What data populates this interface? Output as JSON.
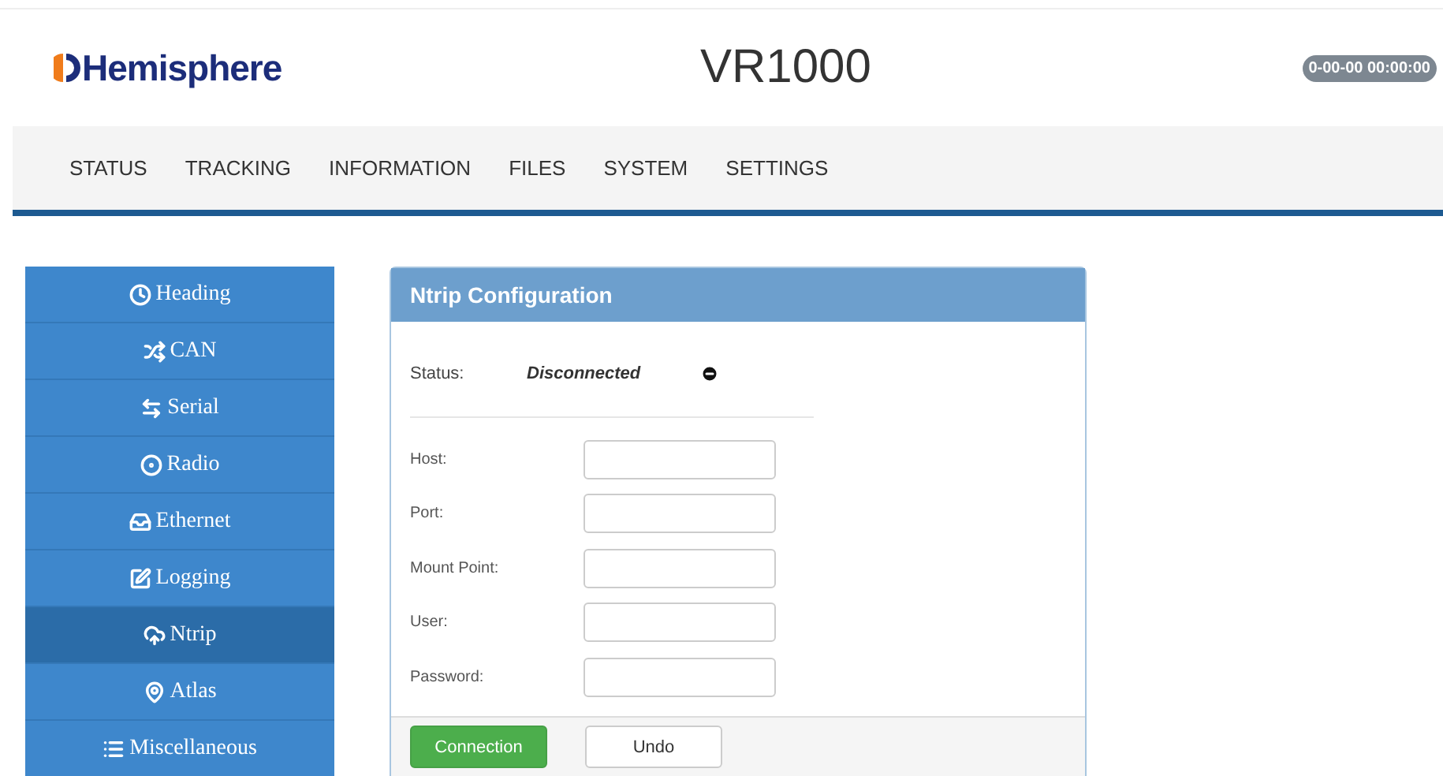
{
  "header": {
    "logo_text": "Hemisphere",
    "title": "VR1000",
    "clock": "0-00-00 00:00:00"
  },
  "nav": [
    "STATUS",
    "TRACKING",
    "INFORMATION",
    "FILES",
    "SYSTEM",
    "SETTINGS"
  ],
  "sidebar": [
    {
      "label": "Heading",
      "selected": false
    },
    {
      "label": "CAN",
      "selected": false
    },
    {
      "label": "Serial",
      "selected": false
    },
    {
      "label": "Radio",
      "selected": false
    },
    {
      "label": "Ethernet",
      "selected": false
    },
    {
      "label": "Logging",
      "selected": false
    },
    {
      "label": "Ntrip",
      "selected": true
    },
    {
      "label": "Atlas",
      "selected": false
    },
    {
      "label": "Miscellaneous",
      "selected": false
    }
  ],
  "panel": {
    "title": "Ntrip Configuration",
    "status_label": "Status:",
    "status_value": "Disconnected",
    "fields": [
      "Host:",
      "Port:",
      "Mount Point:",
      "User:",
      "Password:"
    ],
    "buttons": [
      {
        "label": "Connection",
        "kind": "primary"
      },
      {
        "label": "Undo",
        "kind": "default"
      }
    ]
  }
}
